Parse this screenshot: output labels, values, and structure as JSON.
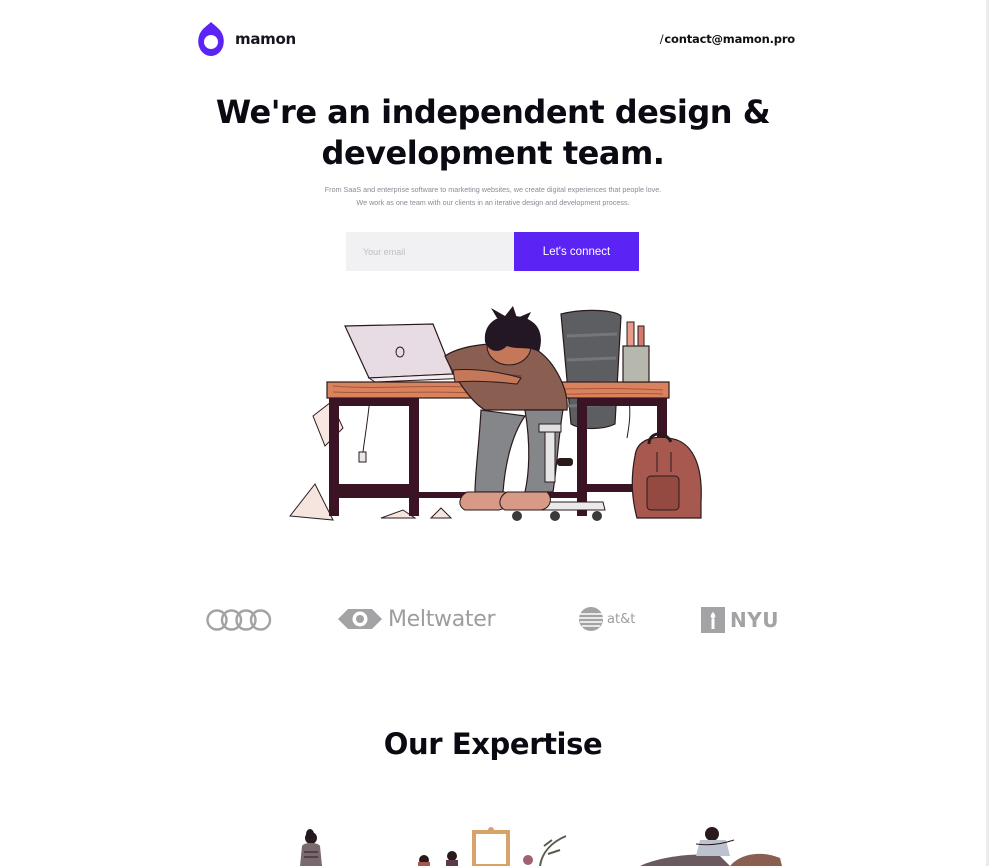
{
  "brand": {
    "name": "mamon",
    "accent": "#5b24f5"
  },
  "header": {
    "contact_prefix": "/",
    "contact_email": "contact@mamon.pro"
  },
  "hero": {
    "title_line1": "We're an independent design &",
    "title_line2": "development team.",
    "subtitle_line1": "From SaaS and enterprise software to marketing websites, we create digital experiences that people love.",
    "subtitle_line2": "We work as one team with our clients in an iterative design and development process."
  },
  "signup": {
    "email_placeholder": "Your email",
    "email_value": "",
    "button_label": "Let's connect"
  },
  "clients": {
    "meltwater": "Meltwater",
    "att": "at&t",
    "nyu": "NYU"
  },
  "expertise": {
    "title": "Our Expertise"
  },
  "icons": [
    "mamon-logo-icon",
    "sleeping-developer-illustration",
    "audi-logo",
    "meltwater-logo",
    "att-logo",
    "nyu-logo"
  ]
}
